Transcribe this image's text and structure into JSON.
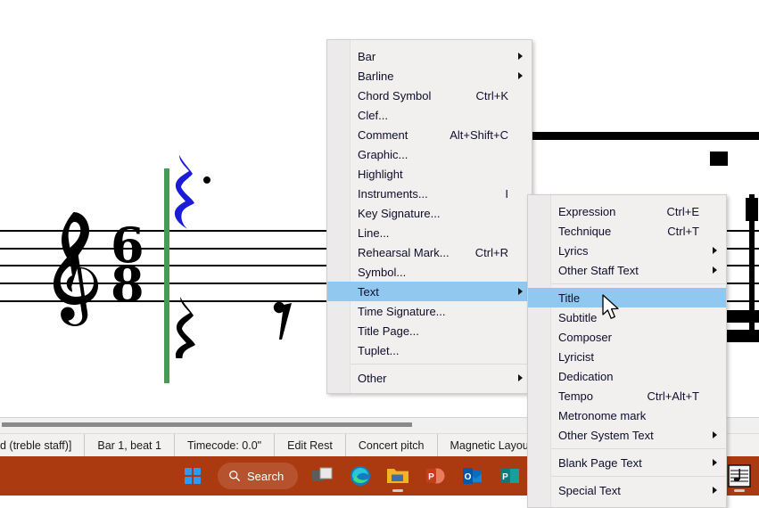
{
  "app": {
    "name": "MuseScore",
    "accent_highlight": "#91c8ef",
    "menu_background": "#f1f0ef",
    "taskbar_color": "#ac3a10",
    "cursor_line_color": "#4a9a53",
    "selected_note_color": "#1b1bd8"
  },
  "score": {
    "clef": "treble clef",
    "time_signature_numerator": "6",
    "time_signature_denominator": "8",
    "symbols": [
      "dotted-quarter-rest-selected",
      "quarter-rest",
      "eighth-rest"
    ]
  },
  "menu_create": {
    "name": "Add / Create menu",
    "items": [
      {
        "label": "Bar",
        "accel": "",
        "submenu": true,
        "separator_before": false
      },
      {
        "label": "Barline",
        "accel": "",
        "submenu": true,
        "separator_before": false
      },
      {
        "label": "Chord Symbol",
        "accel": "Ctrl+K",
        "submenu": false,
        "separator_before": false
      },
      {
        "label": "Clef...",
        "accel": "",
        "submenu": false,
        "separator_before": false
      },
      {
        "label": "Comment",
        "accel": "Alt+Shift+C",
        "submenu": false,
        "separator_before": false
      },
      {
        "label": "Graphic...",
        "accel": "",
        "submenu": false,
        "separator_before": false
      },
      {
        "label": "Highlight",
        "accel": "",
        "submenu": false,
        "separator_before": false
      },
      {
        "label": "Instruments...",
        "accel": "I",
        "submenu": false,
        "separator_before": false
      },
      {
        "label": "Key Signature...",
        "accel": "",
        "submenu": false,
        "separator_before": false
      },
      {
        "label": "Line...",
        "accel": "",
        "submenu": false,
        "separator_before": false
      },
      {
        "label": "Rehearsal Mark...",
        "accel": "Ctrl+R",
        "submenu": false,
        "separator_before": false
      },
      {
        "label": "Symbol...",
        "accel": "",
        "submenu": false,
        "separator_before": false
      },
      {
        "label": "Text",
        "accel": "",
        "submenu": true,
        "separator_before": false,
        "selected": true
      },
      {
        "label": "Time Signature...",
        "accel": "",
        "submenu": false,
        "separator_before": false
      },
      {
        "label": "Title Page...",
        "accel": "",
        "submenu": false,
        "separator_before": false
      },
      {
        "label": "Tuplet...",
        "accel": "",
        "submenu": false,
        "separator_before": false
      },
      {
        "label": "Other",
        "accel": "",
        "submenu": true,
        "separator_before": true
      }
    ]
  },
  "menu_text": {
    "name": "Text submenu",
    "items": [
      {
        "label": "Expression",
        "accel": "Ctrl+E",
        "submenu": false,
        "separator_before": false
      },
      {
        "label": "Technique",
        "accel": "Ctrl+T",
        "submenu": false,
        "separator_before": false
      },
      {
        "label": "Lyrics",
        "accel": "",
        "submenu": true,
        "separator_before": false
      },
      {
        "label": "Other Staff Text",
        "accel": "",
        "submenu": true,
        "separator_before": false
      },
      {
        "label": "Title",
        "accel": "",
        "submenu": false,
        "separator_before": true,
        "selected": true
      },
      {
        "label": "Subtitle",
        "accel": "",
        "submenu": false,
        "separator_before": false
      },
      {
        "label": "Composer",
        "accel": "",
        "submenu": false,
        "separator_before": false
      },
      {
        "label": "Lyricist",
        "accel": "",
        "submenu": false,
        "separator_before": false
      },
      {
        "label": "Dedication",
        "accel": "",
        "submenu": false,
        "separator_before": false
      },
      {
        "label": "Tempo",
        "accel": "Ctrl+Alt+T",
        "submenu": false,
        "separator_before": false
      },
      {
        "label": "Metronome mark",
        "accel": "",
        "submenu": false,
        "separator_before": false
      },
      {
        "label": "Other System Text",
        "accel": "",
        "submenu": true,
        "separator_before": false
      },
      {
        "label": "Blank Page Text",
        "accel": "",
        "submenu": true,
        "separator_before": true
      },
      {
        "label": "Special Text",
        "accel": "",
        "submenu": true,
        "separator_before": true
      }
    ]
  },
  "status_bar": {
    "cells": [
      "d (treble staff)]",
      "Bar 1, beat 1",
      "Timecode: 0.0\"",
      "Edit Rest",
      "Concert pitch",
      "Magnetic Layout: Default"
    ]
  },
  "taskbar": {
    "search_label": "Search",
    "items": [
      {
        "name": "start-button",
        "icon": "windows-logo-icon"
      },
      {
        "name": "search-box",
        "icon": "search-icon"
      },
      {
        "name": "task-view-button",
        "icon": "task-view-icon"
      },
      {
        "name": "edge-button",
        "icon": "edge-icon"
      },
      {
        "name": "file-explorer-button",
        "icon": "folder-icon"
      },
      {
        "name": "powerpoint-button",
        "icon": "powerpoint-icon",
        "letter": "P"
      },
      {
        "name": "outlook-button",
        "icon": "outlook-icon",
        "letter": "O"
      },
      {
        "name": "publisher-button",
        "icon": "publisher-icon",
        "letter": "P"
      },
      {
        "name": "musescore-button",
        "icon": "musescore-icon"
      }
    ]
  }
}
